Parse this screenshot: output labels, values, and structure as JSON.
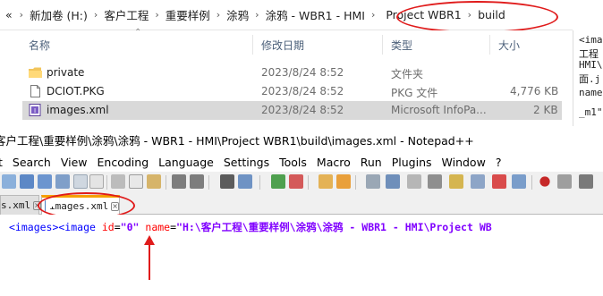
{
  "explorer": {
    "breadcrumb": {
      "overflow": "«",
      "items": [
        "新加卷 (H:)",
        "客户工程",
        "重要样例",
        "涂鸦",
        "涂鸦 - WBR1 - HMI",
        "Project WBR1",
        "build"
      ]
    },
    "columns": {
      "name": "名称",
      "modified": "修改日期",
      "type": "类型",
      "size": "大小"
    },
    "files": [
      {
        "name": "private",
        "modified": "2023/8/24 8:52",
        "type": "文件夹",
        "size": "",
        "icon": "folder-icon"
      },
      {
        "name": "DCIOT.PKG",
        "modified": "2023/8/24 8:52",
        "type": "PKG 文件",
        "size": "4,776 KB",
        "icon": "file-icon"
      },
      {
        "name": "images.xml",
        "modified": "2023/8/24 8:52",
        "type": "Microsoft InfoPa...",
        "size": "2 KB",
        "icon": "xml-file-icon",
        "selected": true
      }
    ],
    "preview_lines": [
      "<ima",
      "工程",
      "HMI\\",
      "面.j",
      "name",
      "_m1\""
    ]
  },
  "notepad": {
    "title": "客户工程\\重要样例\\涂鸦\\涂鸦 - WBR1 - HMI\\Project WBR1\\build\\images.xml - Notepad++",
    "menu": [
      "t",
      "Search",
      "View",
      "Encoding",
      "Language",
      "Settings",
      "Tools",
      "Macro",
      "Run",
      "Plugins",
      "Window",
      "?"
    ],
    "tabs": [
      {
        "label": "s.xml",
        "active": false
      },
      {
        "label": "images.xml",
        "active": true
      }
    ],
    "code": {
      "open_tags": "<images><image",
      "attr_id": "id",
      "val_id": "\"0\"",
      "attr_name": "name",
      "val_name": "\"H:\\客户工程\\重要样例\\涂鸦\\涂鸦 - WBR1 - HMI\\Project WB"
    }
  },
  "colors": {
    "annotation_red": "#e01b1b",
    "active_tab_accent": "#f6a000",
    "xml_tag": "#0000ff",
    "xml_attr": "#ff0000",
    "xml_value": "#8000ff"
  }
}
